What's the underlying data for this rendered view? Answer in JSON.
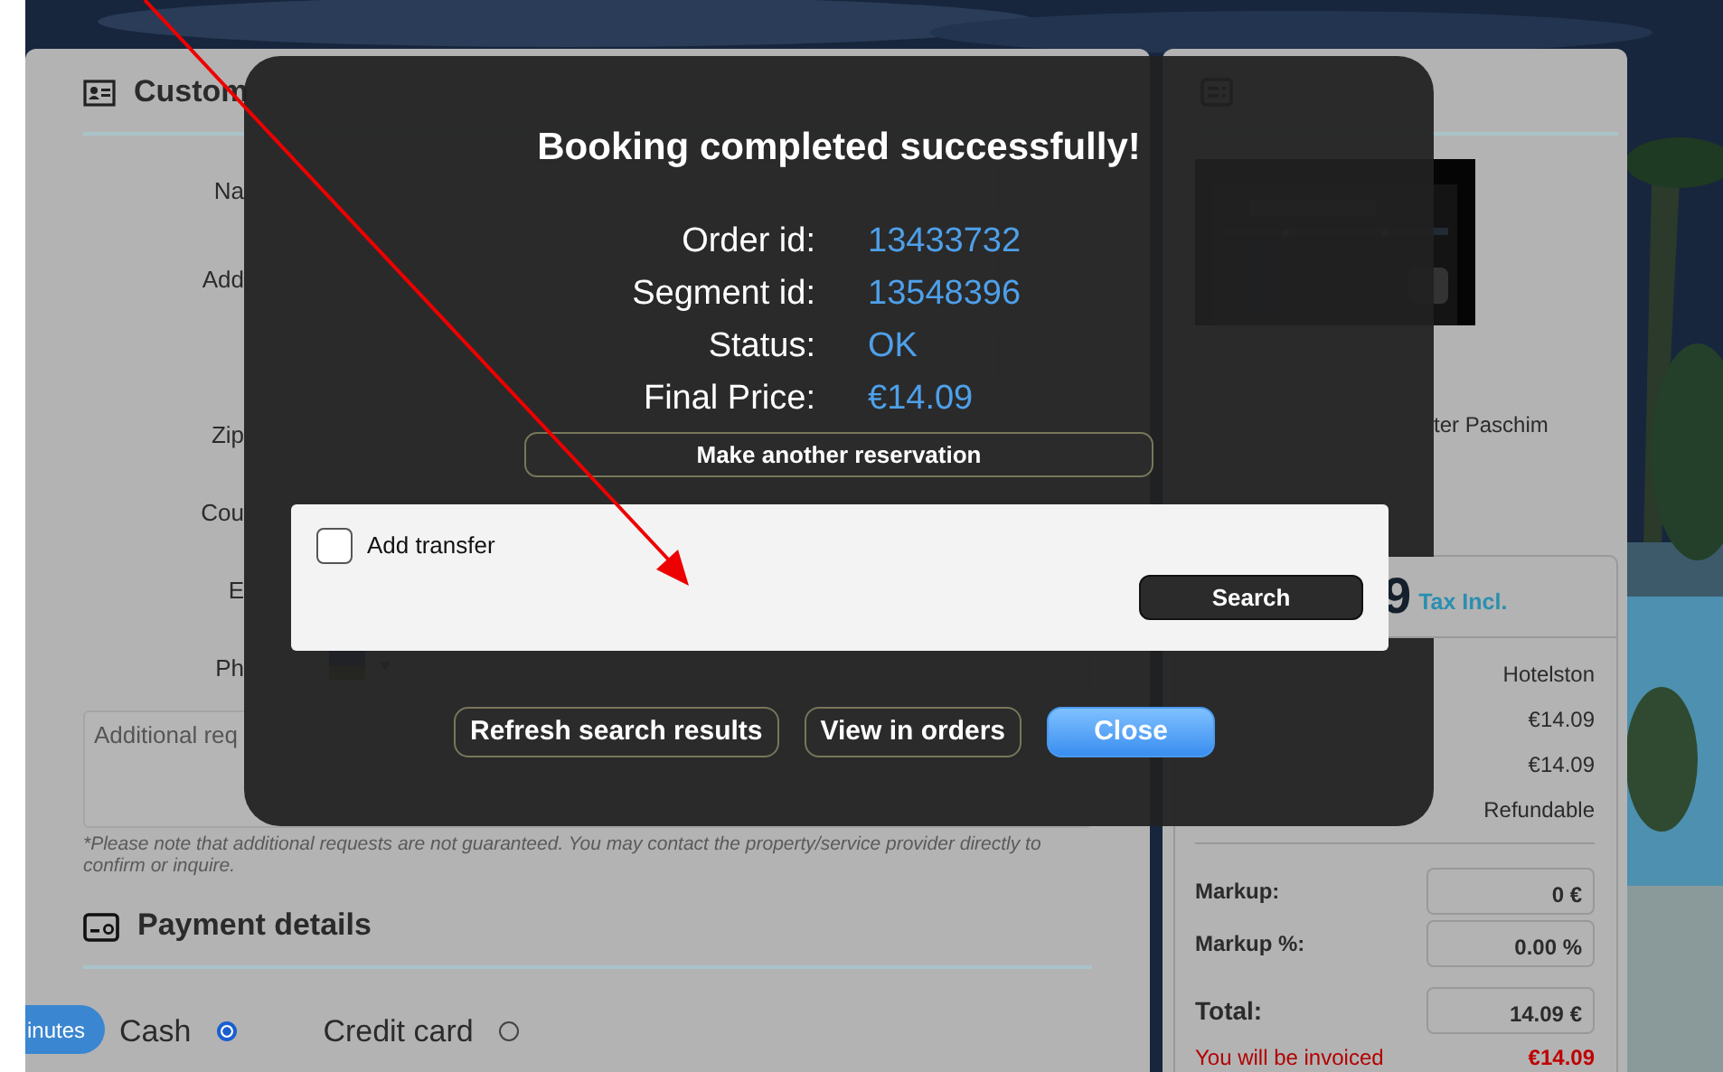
{
  "customer_details": {
    "title": "Custom",
    "fields": [
      {
        "kind": "name",
        "label": "Na"
      },
      {
        "kind": "text",
        "label": "Add"
      },
      {
        "kind": "text"
      },
      {
        "kind": "short",
        "label": "Zip"
      },
      {
        "kind": "hidden",
        "label": "Cou"
      },
      {
        "kind": "hidden",
        "label": "E"
      },
      {
        "kind": "phone",
        "label": "Ph"
      }
    ],
    "additional_requests": {
      "placeholder": "Additional req"
    },
    "requests_note": "*Please note that additional requests are not guaranteed. You may contact the property/service provider directly to confirm or inquire."
  },
  "payment_details": {
    "title": "Payment details",
    "options": [
      {
        "label": "Cash",
        "selected": true
      },
      {
        "label": "Credit card",
        "selected": false
      }
    ]
  },
  "timer_badge": "inutes",
  "order_details": {
    "address_visible": "ter Paschim",
    "price_card": {
      "price_visible": "9",
      "tax_note": "Tax Incl.",
      "rows": [
        {
          "value": "Hotelston"
        },
        {
          "value": "€14.09"
        },
        {
          "value": "€14.09"
        },
        {
          "value": "Refundable"
        }
      ],
      "inputs": [
        {
          "kind": "small",
          "label": "Markup:",
          "value": "0 €"
        },
        {
          "kind": "small",
          "label": "Markup %:",
          "value": "0.00 %"
        },
        {
          "kind": "total",
          "label": "Total:",
          "value": "14.09 €"
        }
      ],
      "invoice": {
        "label": "You will be invoiced",
        "value": "€14.09"
      }
    }
  },
  "modal": {
    "title": "Booking completed successfully!",
    "details": [
      {
        "label": "Order id:",
        "value": "13433732"
      },
      {
        "label": "Segment id:",
        "value": "13548396"
      },
      {
        "label": "Status:",
        "value": "OK"
      },
      {
        "label": "Final Price:",
        "value": "€14.09"
      }
    ],
    "make_another_button": "Make another reservation",
    "transfer": {
      "label": "Add transfer",
      "checked": false
    },
    "search_button": "Search",
    "buttons": [
      {
        "kind": "secondary",
        "label": "Refresh search results"
      },
      {
        "kind": "secondary",
        "label": "View in orders"
      },
      {
        "kind": "primary",
        "label": "Close"
      }
    ]
  }
}
